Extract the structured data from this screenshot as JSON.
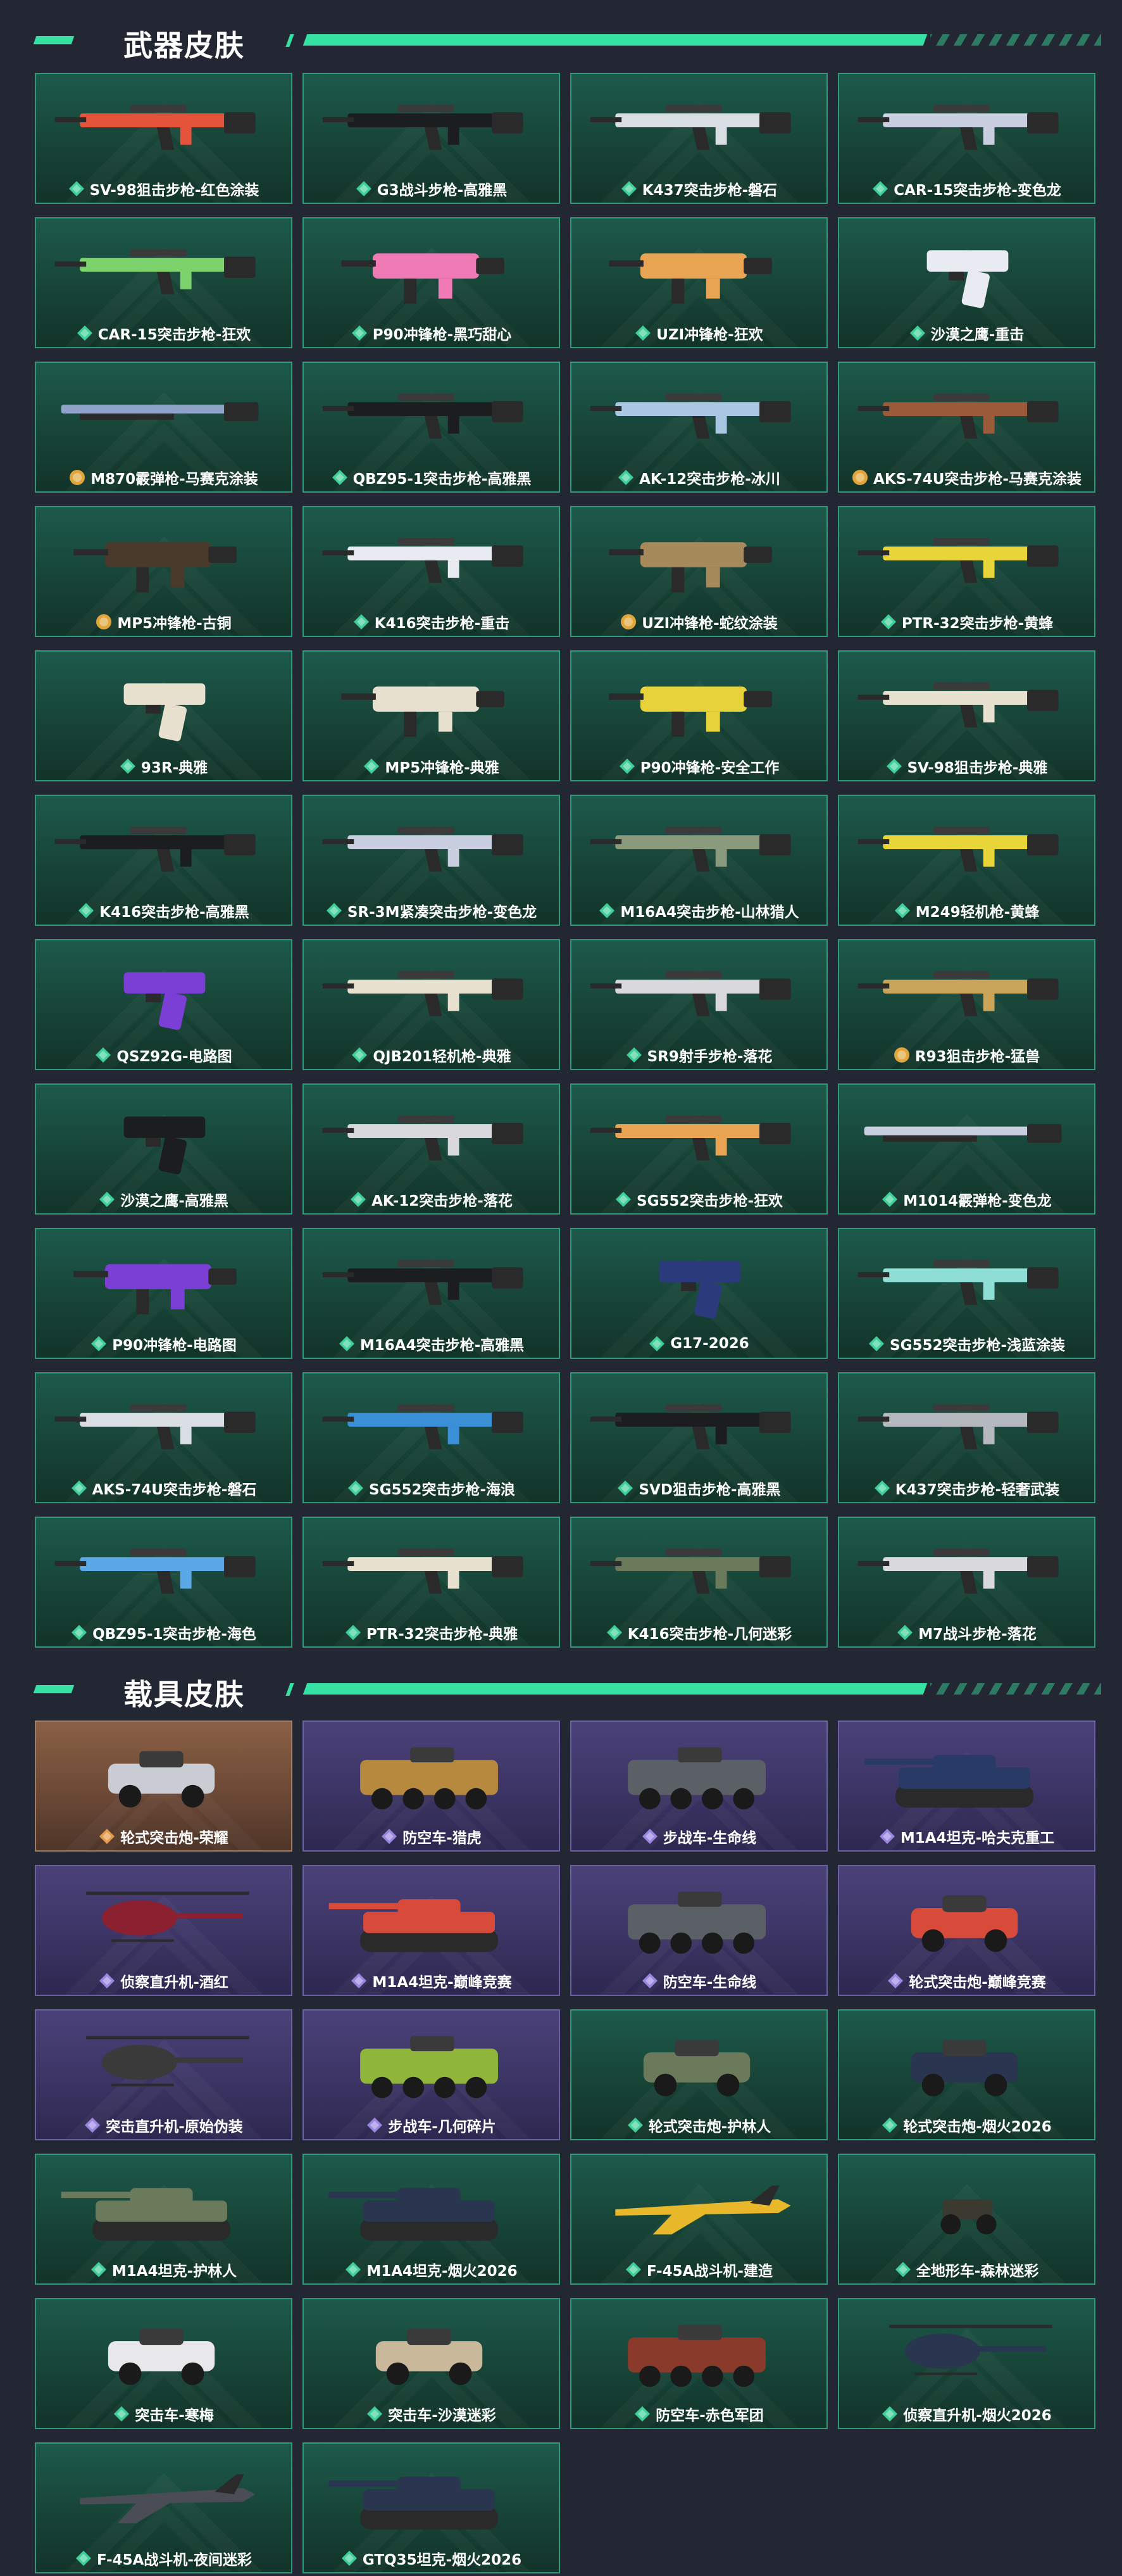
{
  "colors": {
    "page_bg": "#232633",
    "accent": "#35e2a3",
    "teal_card": "#174437",
    "purple_card": "#3a3362",
    "orange_card": "#6a4735",
    "quality_green": "#3fcf9a",
    "quality_purple": "#9a86e0",
    "quality_orange": "#e59a4a",
    "quality_gold": "#e0a63a"
  },
  "weapons_section": {
    "title": "武器皮肤",
    "items": [
      {
        "label": "SV-98狙击步枪-红色涂装",
        "quality": "green",
        "theme": "teal",
        "icon": "rifle-icon",
        "color": "#e5533b"
      },
      {
        "label": "G3战斗步枪-高雅黑",
        "quality": "green",
        "theme": "teal",
        "icon": "rifle-icon",
        "color": "#1b1d1f"
      },
      {
        "label": "K437突击步枪-磐石",
        "quality": "green",
        "theme": "teal",
        "icon": "rifle-icon",
        "color": "#d9dde4"
      },
      {
        "label": "CAR-15突击步枪-变色龙",
        "quality": "green",
        "theme": "teal",
        "icon": "rifle-icon",
        "color": "#c9cfe0"
      },
      {
        "label": "CAR-15突击步枪-狂欢",
        "quality": "green",
        "theme": "teal",
        "icon": "rifle-icon",
        "color": "#7dd36b"
      },
      {
        "label": "P90冲锋枪-黑巧甜心",
        "quality": "green",
        "theme": "teal",
        "icon": "smg-icon",
        "color": "#f07ab5"
      },
      {
        "label": "UZI冲锋枪-狂欢",
        "quality": "green",
        "theme": "teal",
        "icon": "smg-icon",
        "color": "#e9a553"
      },
      {
        "label": "沙漠之鹰-重击",
        "quality": "green",
        "theme": "teal",
        "icon": "pistol-icon",
        "color": "#e8ebf2"
      },
      {
        "label": "M870霰弹枪-马赛克涂装",
        "quality": "gold",
        "theme": "teal",
        "icon": "shotgun-icon",
        "color": "#8fa3c8"
      },
      {
        "label": "QBZ95-1突击步枪-高雅黑",
        "quality": "green",
        "theme": "teal",
        "icon": "rifle-icon",
        "color": "#1b1d1f"
      },
      {
        "label": "AK-12突击步枪-冰川",
        "quality": "green",
        "theme": "teal",
        "icon": "rifle-icon",
        "color": "#a9c7e3"
      },
      {
        "label": "AKS-74U突击步枪-马赛克涂装",
        "quality": "gold",
        "theme": "teal",
        "icon": "rifle-icon",
        "color": "#9b5a3a"
      },
      {
        "label": "MP5冲锋枪-古铜",
        "quality": "gold",
        "theme": "teal",
        "icon": "smg-icon",
        "color": "#4a3a2c"
      },
      {
        "label": "K416突击步枪-重击",
        "quality": "green",
        "theme": "teal",
        "icon": "rifle-icon",
        "color": "#e8ebf2"
      },
      {
        "label": "UZI冲锋枪-蛇纹涂装",
        "quality": "gold",
        "theme": "teal",
        "icon": "smg-icon",
        "color": "#a68a5c"
      },
      {
        "label": "PTR-32突击步枪-黄蜂",
        "quality": "green",
        "theme": "teal",
        "icon": "rifle-icon",
        "color": "#e8d53a"
      },
      {
        "label": "93R-典雅",
        "quality": "green",
        "theme": "teal",
        "icon": "pistol-icon",
        "color": "#e9e1cf"
      },
      {
        "label": "MP5冲锋枪-典雅",
        "quality": "green",
        "theme": "teal",
        "icon": "smg-icon",
        "color": "#e9e1cf"
      },
      {
        "label": "P90冲锋枪-安全工作",
        "quality": "green",
        "theme": "teal",
        "icon": "smg-icon",
        "color": "#e8d23a"
      },
      {
        "label": "SV-98狙击步枪-典雅",
        "quality": "green",
        "theme": "teal",
        "icon": "rifle-icon",
        "color": "#e9e1cf"
      },
      {
        "label": "K416突击步枪-高雅黑",
        "quality": "green",
        "theme": "teal",
        "icon": "rifle-icon",
        "color": "#1b1d1f"
      },
      {
        "label": "SR-3M紧凑突击步枪-变色龙",
        "quality": "green",
        "theme": "teal",
        "icon": "rifle-icon",
        "color": "#c9cfe0"
      },
      {
        "label": "M16A4突击步枪-山林猎人",
        "quality": "green",
        "theme": "teal",
        "icon": "rifle-icon",
        "color": "#8a9a7c"
      },
      {
        "label": "M249轻机枪-黄蜂",
        "quality": "green",
        "theme": "teal",
        "icon": "rifle-icon",
        "color": "#e8d53a"
      },
      {
        "label": "QSZ92G-电路图",
        "quality": "green",
        "theme": "teal",
        "icon": "pistol-icon",
        "color": "#7b3fd6"
      },
      {
        "label": "QJB201轻机枪-典雅",
        "quality": "green",
        "theme": "teal",
        "icon": "rifle-icon",
        "color": "#e9e1cf"
      },
      {
        "label": "SR9射手步枪-落花",
        "quality": "green",
        "theme": "teal",
        "icon": "rifle-icon",
        "color": "#d9d9dd"
      },
      {
        "label": "R93狙击步枪-猛兽",
        "quality": "gold",
        "theme": "teal",
        "icon": "rifle-icon",
        "color": "#c9a55a"
      },
      {
        "label": "沙漠之鹰-高雅黑",
        "quality": "green",
        "theme": "teal",
        "icon": "pistol-icon",
        "color": "#1b1d1f"
      },
      {
        "label": "AK-12突击步枪-落花",
        "quality": "green",
        "theme": "teal",
        "icon": "rifle-icon",
        "color": "#d9d9dd"
      },
      {
        "label": "SG552突击步枪-狂欢",
        "quality": "green",
        "theme": "teal",
        "icon": "rifle-icon",
        "color": "#e9a553"
      },
      {
        "label": "M1014霰弹枪-变色龙",
        "quality": "green",
        "theme": "teal",
        "icon": "shotgun-icon",
        "color": "#c9cfe0"
      },
      {
        "label": "P90冲锋枪-电路图",
        "quality": "green",
        "theme": "teal",
        "icon": "smg-icon",
        "color": "#7b3fd6"
      },
      {
        "label": "M16A4突击步枪-高雅黑",
        "quality": "green",
        "theme": "teal",
        "icon": "rifle-icon",
        "color": "#1b1d1f"
      },
      {
        "label": "G17-2026",
        "quality": "green",
        "theme": "teal",
        "icon": "pistol-icon",
        "color": "#2a3a7a"
      },
      {
        "label": "SG552突击步枪-浅蓝涂装",
        "quality": "green",
        "theme": "teal",
        "icon": "rifle-icon",
        "color": "#8fded5"
      },
      {
        "label": "AKS-74U突击步枪-磐石",
        "quality": "green",
        "theme": "teal",
        "icon": "rifle-icon",
        "color": "#d9dde4"
      },
      {
        "label": "SG552突击步枪-海浪",
        "quality": "green",
        "theme": "teal",
        "icon": "rifle-icon",
        "color": "#3b8fd6"
      },
      {
        "label": "SVD狙击步枪-高雅黑",
        "quality": "green",
        "theme": "teal",
        "icon": "rifle-icon",
        "color": "#1b1d1f"
      },
      {
        "label": "K437突击步枪-轻奢武装",
        "quality": "green",
        "theme": "teal",
        "icon": "rifle-icon",
        "color": "#b5b8bf"
      },
      {
        "label": "QBZ95-1突击步枪-海色",
        "quality": "green",
        "theme": "teal",
        "icon": "rifle-icon",
        "color": "#5aa8e8"
      },
      {
        "label": "PTR-32突击步枪-典雅",
        "quality": "green",
        "theme": "teal",
        "icon": "rifle-icon",
        "color": "#e9e1cf"
      },
      {
        "label": "K416突击步枪-几何迷彩",
        "quality": "green",
        "theme": "teal",
        "icon": "rifle-icon",
        "color": "#6b7a5a"
      },
      {
        "label": "M7战斗步枪-落花",
        "quality": "green",
        "theme": "teal",
        "icon": "rifle-icon",
        "color": "#d9d9dd"
      }
    ]
  },
  "vehicles_section": {
    "title": "载具皮肤",
    "items": [
      {
        "label": "轮式突击炮-荣耀",
        "quality": "orange",
        "theme": "orange",
        "icon": "armored-car-icon",
        "color": "#c9ccd2"
      },
      {
        "label": "防空车-猎虎",
        "quality": "purple",
        "theme": "purple",
        "icon": "apc-icon",
        "color": "#b7893e"
      },
      {
        "label": "步战车-生命线",
        "quality": "purple",
        "theme": "purple",
        "icon": "apc-icon",
        "color": "#5b5f66"
      },
      {
        "label": "M1A4坦克-哈夫克重工",
        "quality": "purple",
        "theme": "purple",
        "icon": "tank-icon",
        "color": "#2a3a66"
      },
      {
        "label": "侦察直升机-酒红",
        "quality": "purple",
        "theme": "purple",
        "icon": "helicopter-icon",
        "color": "#8a2030"
      },
      {
        "label": "M1A4坦克-巅峰竞赛",
        "quality": "purple",
        "theme": "purple",
        "icon": "tank-icon",
        "color": "#d84a3a"
      },
      {
        "label": "防空车-生命线",
        "quality": "purple",
        "theme": "purple",
        "icon": "apc-icon",
        "color": "#5b5f66"
      },
      {
        "label": "轮式突击炮-巅峰竞赛",
        "quality": "purple",
        "theme": "purple",
        "icon": "armored-car-icon",
        "color": "#d84a3a"
      },
      {
        "label": "突击直升机-原始伪装",
        "quality": "purple",
        "theme": "purple",
        "icon": "helicopter-icon",
        "color": "#3a3a3a"
      },
      {
        "label": "步战车-几何碎片",
        "quality": "purple",
        "theme": "purple",
        "icon": "apc-icon",
        "color": "#8fb53a"
      },
      {
        "label": "轮式突击炮-护林人",
        "quality": "green",
        "theme": "teal",
        "icon": "armored-car-icon",
        "color": "#6b7a5a"
      },
      {
        "label": "轮式突击炮-烟火2026",
        "quality": "green",
        "theme": "teal",
        "icon": "armored-car-icon",
        "color": "#2a3550"
      },
      {
        "label": "M1A4坦克-护林人",
        "quality": "green",
        "theme": "teal",
        "icon": "tank-icon",
        "color": "#6b7a5a"
      },
      {
        "label": "M1A4坦克-烟火2026",
        "quality": "green",
        "theme": "teal",
        "icon": "tank-icon",
        "color": "#2a3550"
      },
      {
        "label": "F-45A战斗机-建造",
        "quality": "green",
        "theme": "teal",
        "icon": "jet-icon",
        "color": "#e8b82a"
      },
      {
        "label": "全地形车-森林迷彩",
        "quality": "green",
        "theme": "teal",
        "icon": "atv-icon",
        "color": "#3a3a30"
      },
      {
        "label": "突击车-寒梅",
        "quality": "green",
        "theme": "teal",
        "icon": "armored-car-icon",
        "color": "#e8e8ea"
      },
      {
        "label": "突击车-沙漠迷彩",
        "quality": "green",
        "theme": "teal",
        "icon": "armored-car-icon",
        "color": "#c9b89a"
      },
      {
        "label": "防空车-赤色军团",
        "quality": "green",
        "theme": "teal",
        "icon": "apc-icon",
        "color": "#8a3a2a"
      },
      {
        "label": "侦察直升机-烟火2026",
        "quality": "green",
        "theme": "teal",
        "icon": "helicopter-icon",
        "color": "#2a3550"
      },
      {
        "label": "F-45A战斗机-夜间迷彩",
        "quality": "green",
        "theme": "teal",
        "icon": "jet-icon",
        "color": "#4a4d55"
      },
      {
        "label": "GTQ35坦克-烟火2026",
        "quality": "green",
        "theme": "teal",
        "icon": "tank-icon",
        "color": "#2a3550"
      }
    ]
  }
}
